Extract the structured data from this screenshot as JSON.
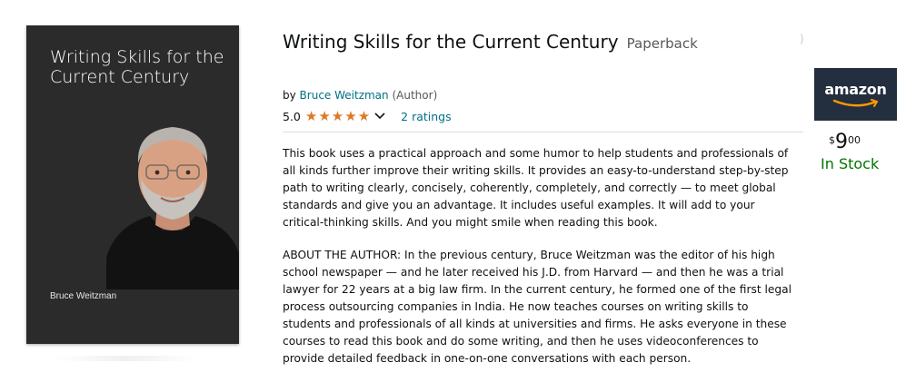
{
  "cover": {
    "title": "Writing Skills for the Current Century",
    "author": "Bruce Weitzman"
  },
  "product": {
    "title": "Writing Skills for the Current Century",
    "format": "Paperback",
    "by_prefix": "by",
    "author": "Bruce Weitzman",
    "author_role": "(Author)",
    "rating_value": "5.0",
    "stars": 5,
    "ratings_count_label": "2 ratings",
    "description": "This book uses a practical approach and some humor to help students and professionals of all kinds further improve their writing skills. It provides an easy-to-understand step-by-step path to writing clearly, concisely, coherently, completely, and correctly — to meet global standards and give you an advantage. It includes useful examples. It will add to your critical-thinking skills. And you might smile when reading this book.",
    "about_author": "ABOUT THE AUTHOR: In the previous century, Bruce Weitzman was the editor of his high school newspaper — and he later received his J.D. from Harvard — and then he was a trial lawyer for 22 years at a big law firm. In the current century, he formed one of the first legal process outsourcing companies in India. He now teaches courses on writing skills to students and professionals of all kinds at universities and firms. He asks everyone in these courses to read this book and do some writing, and then he uses videoconferences to provide detailed feedback in one-on-one conversations with each person."
  },
  "store": {
    "logo_text": "amazon",
    "price_symbol": "$",
    "price_whole": "9",
    "price_fraction": "00",
    "stock_status": "In Stock"
  },
  "colors": {
    "link": "#007185",
    "star": "#de7921",
    "in_stock": "#007600",
    "logo_bg": "#232f3e",
    "logo_smile": "#ff9900",
    "cover_bg": "#2b2b2b"
  },
  "icons": {
    "rating_dropdown": "chevron-down-icon",
    "star": "star-icon"
  }
}
